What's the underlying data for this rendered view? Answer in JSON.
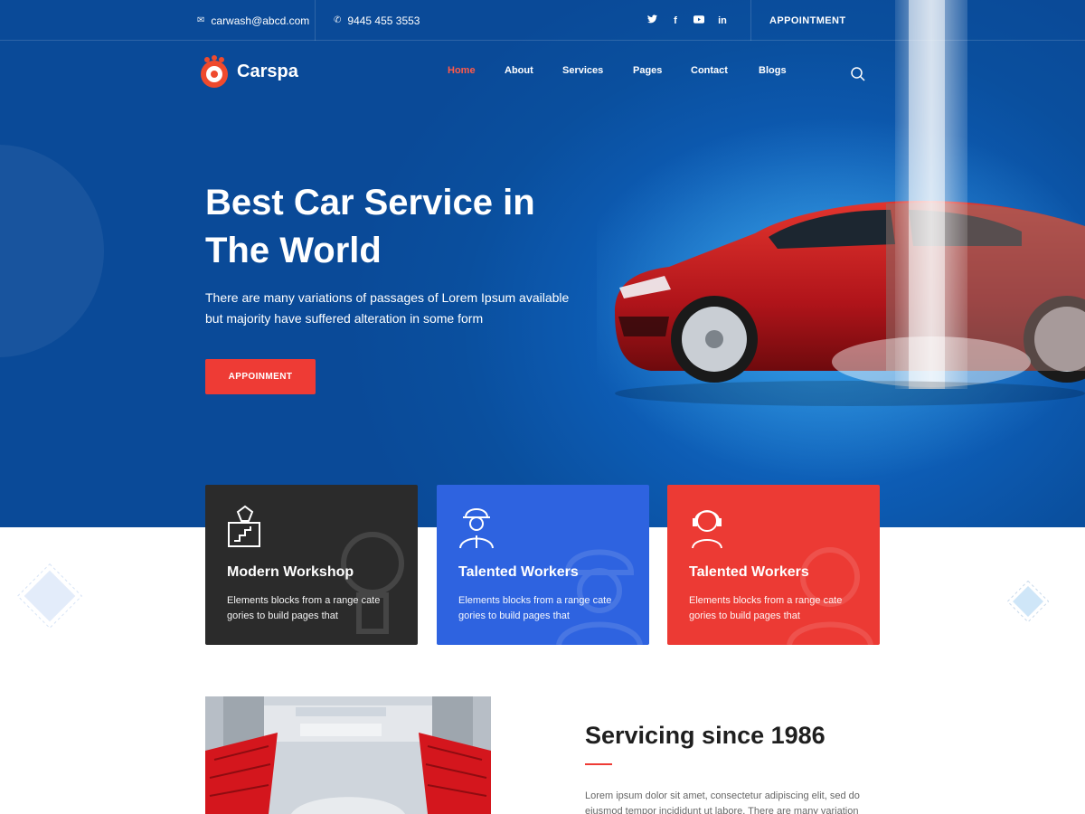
{
  "topbar": {
    "email": "carwash@abcd.com",
    "phone": "9445 455 3553",
    "social": [
      "twitter-icon",
      "facebook-icon",
      "youtube-icon",
      "linkedin-icon"
    ],
    "appointment_label": "APPOINTMENT"
  },
  "brand": {
    "name": "Carspa"
  },
  "nav": {
    "items": [
      {
        "label": "Home",
        "active": true
      },
      {
        "label": "About",
        "active": false
      },
      {
        "label": "Services",
        "active": false
      },
      {
        "label": "Pages",
        "active": false
      },
      {
        "label": "Contact",
        "active": false
      },
      {
        "label": "Blogs",
        "active": false
      }
    ]
  },
  "hero": {
    "title_line1": "Best Car Service in",
    "title_line2": "The World",
    "subtitle_line1": "There are many variations of passages of Lorem Ipsum available",
    "subtitle_line2": "but majority have suffered alteration in some form",
    "button_label": "APPOINMENT"
  },
  "cards": [
    {
      "title": "Modern Workshop",
      "text_line1": "Elements blocks from a range cate",
      "text_line2": "gories to build pages that",
      "color": "#2b2b2b",
      "icon": "workshop-icon"
    },
    {
      "title": "Talented Workers",
      "text_line1": "Elements blocks from a range cate",
      "text_line2": "gories to build pages that",
      "color": "#2e63e0",
      "icon": "worker-icon"
    },
    {
      "title": "Talented Workers",
      "text_line1": "Elements blocks from a range cate",
      "text_line2": "gories to build pages that",
      "color": "#ec3a34",
      "icon": "support-agent-icon"
    }
  ],
  "about": {
    "title": "Servicing since 1986",
    "text_line1": "Lorem ipsum dolor sit amet, consectetur adipiscing elit, sed do",
    "text_line2": "eiusmod tempor incididunt ut labore. There are many variation"
  },
  "colors": {
    "hero_blue": "#0a4f9e",
    "accent_red": "#ee3b35",
    "card_dark": "#2b2b2b",
    "card_blue": "#2e63e0",
    "card_red": "#ec3a34"
  }
}
